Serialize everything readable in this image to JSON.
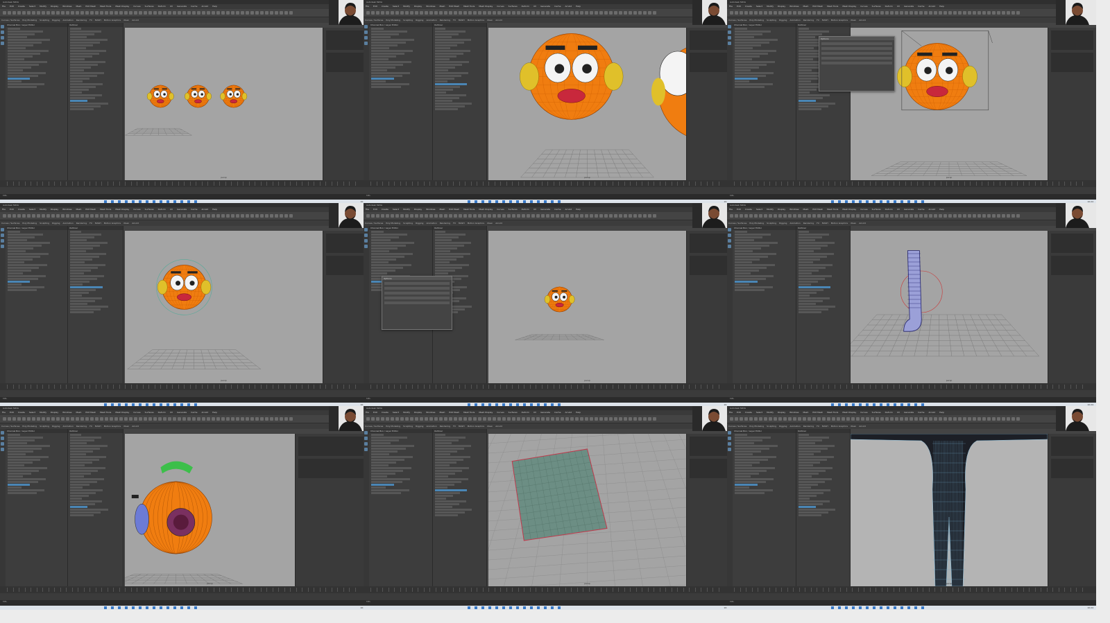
{
  "app": {
    "window_title": "Autodesk MAYA",
    "menus": [
      "File",
      "Edit",
      "Create",
      "Select",
      "Modify",
      "Display",
      "Windows",
      "Mesh",
      "Edit Mesh",
      "Mesh Tools",
      "Mesh Display",
      "Curves",
      "Surfaces",
      "Deform",
      "UV",
      "Generate",
      "Cache",
      "Arnold",
      "Help"
    ],
    "shelf_tabs": [
      "Curves / Surfaces",
      "Poly Modeling",
      "Sculpting",
      "Rigging",
      "Animation",
      "Rendering",
      "FX",
      "MASH",
      "Motion Graphics",
      "XGen",
      "Arnold"
    ],
    "outliner_title": "Outliner",
    "panel_title": "Channel Box / Layer Editor",
    "command_label": "MEL",
    "viewport_label": "persp",
    "taskbar_time": "10:24",
    "dialog_title": "Options",
    "dialog_buttons": [
      "Apply",
      "Close"
    ]
  },
  "tiles": [
    {
      "id": "t1",
      "scene": "three-heads"
    },
    {
      "id": "t2",
      "scene": "big-face"
    },
    {
      "id": "t3",
      "scene": "face-lattice"
    },
    {
      "id": "t4",
      "scene": "head-sphere"
    },
    {
      "id": "t5",
      "scene": "small-head-dialog"
    },
    {
      "id": "t6",
      "scene": "boot"
    },
    {
      "id": "t7",
      "scene": "orange-side"
    },
    {
      "id": "t8",
      "scene": "plane"
    },
    {
      "id": "t9",
      "scene": "legs"
    }
  ],
  "colors": {
    "orange": "#f07d10",
    "accent": "#4a86b5",
    "viewport": "#a4a4a4",
    "panel": "#3d3d3d"
  }
}
